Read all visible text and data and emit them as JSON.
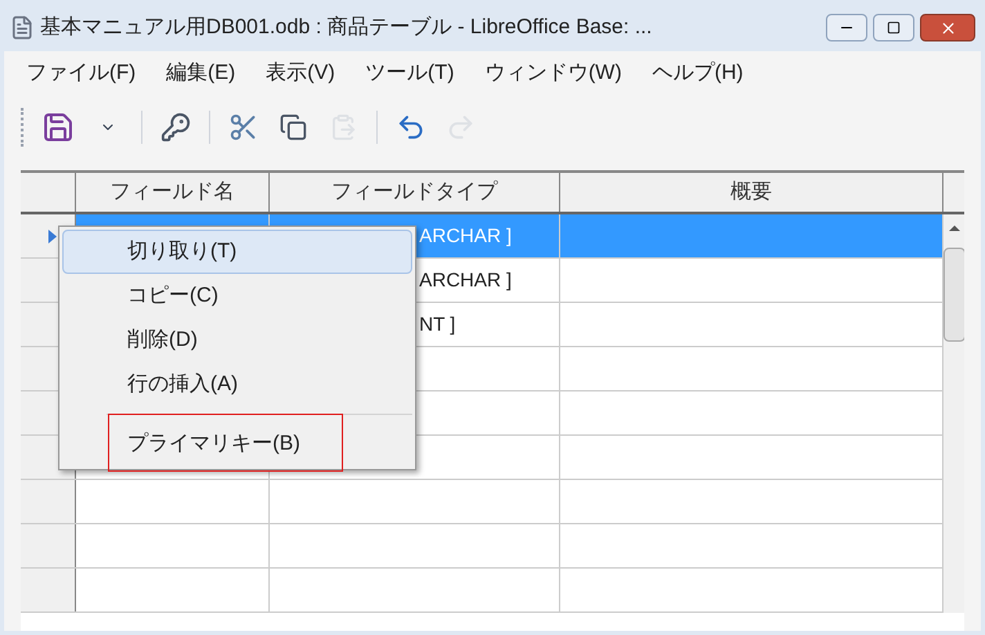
{
  "window": {
    "title": "基本マニュアル用DB001.odb : 商品テーブル - LibreOffice Base: ..."
  },
  "menu": [
    "ファイル(F)",
    "編集(E)",
    "表示(V)",
    "ツール(T)",
    "ウィンドウ(W)",
    "ヘルプ(H)"
  ],
  "toolbar": [
    {
      "kind": "save",
      "disabled": false
    },
    {
      "kind": "dropdown",
      "disabled": false
    },
    {
      "kind": "separator"
    },
    {
      "kind": "primary_key",
      "disabled": false
    },
    {
      "kind": "separator"
    },
    {
      "kind": "cut",
      "disabled": false
    },
    {
      "kind": "copy",
      "disabled": false
    },
    {
      "kind": "paste",
      "disabled": true
    },
    {
      "kind": "separator"
    },
    {
      "kind": "undo",
      "disabled": false
    },
    {
      "kind": "redo",
      "disabled": true
    }
  ],
  "table": {
    "columns": [
      "フィールド名",
      "フィールドタイプ",
      "概要"
    ],
    "rows": [
      {
        "selected": true,
        "current": true,
        "field_type": "ARCHAR ]"
      },
      {
        "selected": false,
        "current": false,
        "field_type": "ARCHAR ]"
      },
      {
        "selected": false,
        "current": false,
        "field_type": "NT ]"
      },
      {
        "selected": false,
        "current": false
      },
      {
        "selected": false,
        "current": false
      },
      {
        "selected": false,
        "current": false
      },
      {
        "selected": false,
        "current": false
      },
      {
        "selected": false,
        "current": false
      },
      {
        "selected": false,
        "current": false
      }
    ]
  },
  "context_menu": {
    "items": [
      {
        "kind": "item",
        "label": "切り取り(T)",
        "selected": true,
        "outlined": false
      },
      {
        "kind": "item",
        "label": "コピー(C)",
        "selected": false,
        "outlined": false
      },
      {
        "kind": "item",
        "label": "削除(D)",
        "selected": false,
        "outlined": false
      },
      {
        "kind": "item",
        "label": "行の挿入(A)",
        "selected": false,
        "outlined": false
      },
      {
        "kind": "separator"
      },
      {
        "kind": "item",
        "label": "プライマリキー(B)",
        "selected": false,
        "outlined": true
      }
    ]
  }
}
